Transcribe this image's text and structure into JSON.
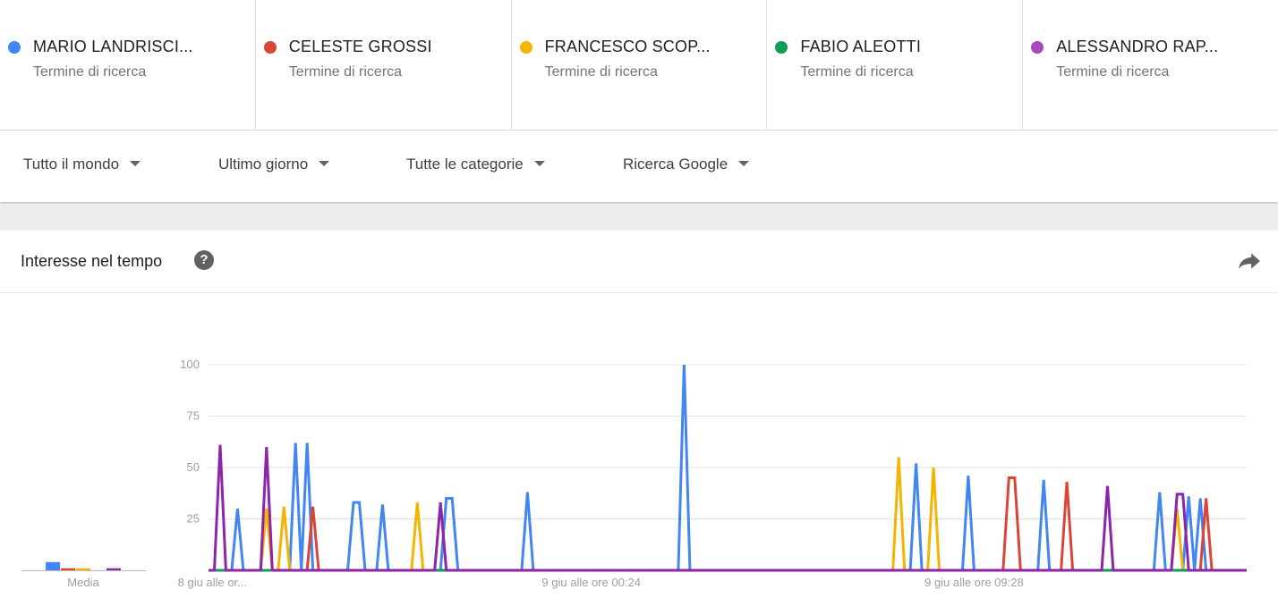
{
  "terms": [
    {
      "name": "MARIO LANDRISCI...",
      "subtitle": "Termine di ricerca",
      "color": "#4285f4"
    },
    {
      "name": "CELESTE GROSSI",
      "subtitle": "Termine di ricerca",
      "color": "#db4437"
    },
    {
      "name": "FRANCESCO SCOP...",
      "subtitle": "Termine di ricerca",
      "color": "#f4b400"
    },
    {
      "name": "FABIO ALEOTTI",
      "subtitle": "Termine di ricerca",
      "color": "#0f9d58"
    },
    {
      "name": "ALESSANDRO RAP...",
      "subtitle": "Termine di ricerca",
      "color": "#ab47bc"
    }
  ],
  "filters": {
    "region": "Tutto il mondo",
    "time": "Ultimo giorno",
    "category": "Tutte le categorie",
    "property": "Ricerca Google"
  },
  "card": {
    "title": "Interesse nel tempo",
    "help_icon": "question-mark-icon",
    "share_icon": "share-arrow-icon"
  },
  "chart_data": {
    "type": "line",
    "title": "Interesse nel tempo",
    "xlabel": "",
    "ylabel": "",
    "ylim": [
      0,
      100
    ],
    "yticks": [
      25,
      50,
      75,
      100
    ],
    "n_points": 180,
    "x_ticks": [
      {
        "label": "8 giu alle or...",
        "index": 0
      },
      {
        "label": "9 giu alle ore 00:24",
        "index": 66
      },
      {
        "label": "9 giu alle ore 09:28",
        "index": 132
      }
    ],
    "grid": true,
    "legend": "none",
    "series": [
      {
        "name": "MARIO LANDRISCI...",
        "color": "#4285f4",
        "spikes": [
          [
            5,
            30
          ],
          [
            15,
            62
          ],
          [
            17,
            62
          ],
          [
            25,
            33
          ],
          [
            26,
            33
          ],
          [
            30,
            32
          ],
          [
            41,
            35
          ],
          [
            42,
            35
          ],
          [
            55,
            38
          ],
          [
            82,
            100
          ],
          [
            122,
            52
          ],
          [
            131,
            46
          ],
          [
            144,
            44
          ],
          [
            164,
            38
          ],
          [
            169,
            36
          ],
          [
            171,
            35
          ]
        ]
      },
      {
        "name": "CELESTE GROSSI",
        "color": "#db4437",
        "spikes": [
          [
            18,
            31
          ],
          [
            138,
            45
          ],
          [
            139,
            45
          ],
          [
            148,
            43
          ],
          [
            172,
            35
          ]
        ]
      },
      {
        "name": "FRANCESCO SCOP...",
        "color": "#f4b400",
        "spikes": [
          [
            10,
            30
          ],
          [
            13,
            31
          ],
          [
            36,
            33
          ],
          [
            119,
            55
          ],
          [
            125,
            50
          ],
          [
            167,
            30
          ]
        ]
      },
      {
        "name": "FABIO ALEOTTI",
        "color": "#0f9d58",
        "spikes": []
      },
      {
        "name": "ALESSANDRO RAP...",
        "color": "#8e24aa",
        "spikes": [
          [
            2,
            61
          ],
          [
            10,
            60
          ],
          [
            40,
            33
          ],
          [
            155,
            41
          ],
          [
            167,
            37
          ],
          [
            168,
            37
          ]
        ]
      }
    ],
    "averages": {
      "label": "Media",
      "values": [
        4,
        1,
        1,
        0,
        1
      ]
    }
  }
}
